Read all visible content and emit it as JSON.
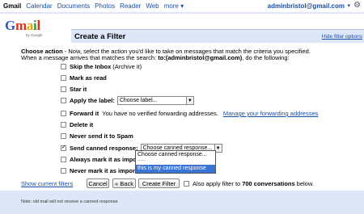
{
  "topbar": {
    "nav": [
      "Gmail",
      "Calendar",
      "Documents",
      "Photos",
      "Reader",
      "Web",
      "more ▾"
    ],
    "account": "adminbristol@gmail.com",
    "account_caret": "▾",
    "gear": "⚙"
  },
  "logo": {
    "g": "G",
    "m": "m",
    "a": "a",
    "i": "i",
    "l": "l",
    "by": "by Google"
  },
  "panel": {
    "title": "Create a Filter",
    "hide_link": "Hide filter options"
  },
  "description": {
    "line1_bold": "Choose action",
    "line1_rest": " - Now, select the action you'd like to take on messages that match the criteria you specified.",
    "line2_pre": "When a message arrives that matches the search: ",
    "line2_query": "to:(adminbristol@gmail.com)",
    "line2_post": ", do the following:"
  },
  "options": {
    "skip_inbox": {
      "label": "Skip the Inbox",
      "note": "(Archive it)",
      "checked": false
    },
    "mark_read": {
      "label": "Mark as read",
      "checked": false
    },
    "star": {
      "label": "Star it",
      "checked": false
    },
    "apply_label": {
      "label": "Apply the label:",
      "select": "Choose label...",
      "checked": false
    },
    "forward": {
      "label": "Forward it",
      "note": "You have no verified forwarding addresses.",
      "link": "Manage your forwarding addresses",
      "checked": false
    },
    "delete": {
      "label": "Delete it",
      "checked": false
    },
    "never_spam": {
      "label": "Never send it to Spam",
      "checked": false
    },
    "canned": {
      "label": "Send canned response:",
      "select": "Choose canned response...",
      "checked": true
    },
    "always_important": {
      "label": "Always mark it as impor",
      "checked": false
    },
    "never_important": {
      "label": "Never mark it as importa",
      "checked": false
    }
  },
  "dropdown": {
    "options": [
      "Choose canned response...",
      "-----",
      "this is my canned response"
    ],
    "selected_index": 2
  },
  "bottom": {
    "show_filters": "Show current filters",
    "cancel": "Cancel",
    "back": "« Back",
    "create": "Create Filter",
    "also_pre": "Also apply filter to",
    "also_count": "700 conversations",
    "also_post": "below."
  },
  "note": "Note: old mail will not receive a canned response",
  "colors": {
    "accent": "#1a4ea6",
    "panel": "#dde7f7",
    "selection": "#3a74d4"
  }
}
